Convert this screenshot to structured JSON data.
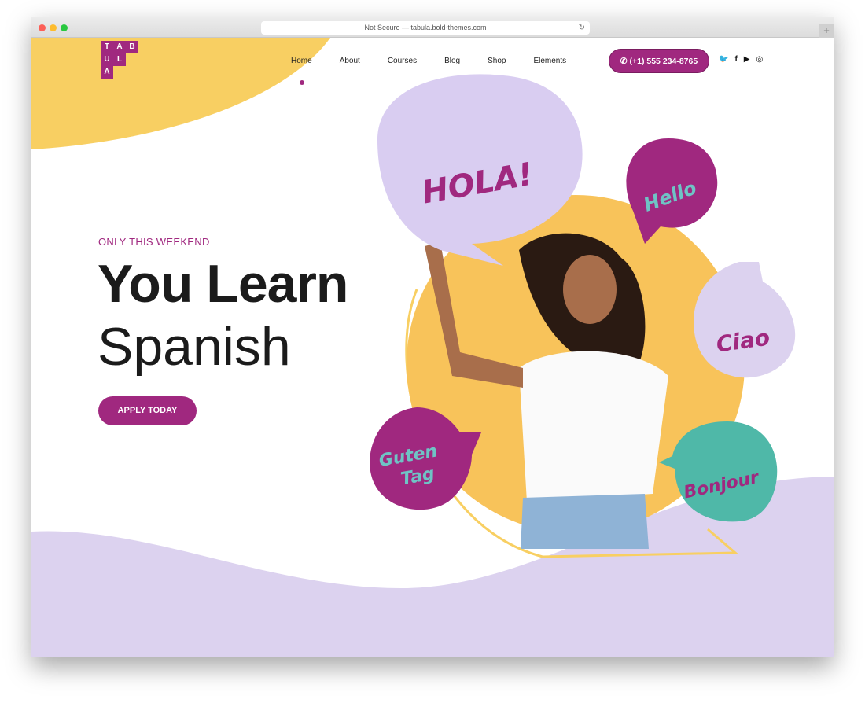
{
  "browser": {
    "url": "Not Secure — tabula.bold-themes.com"
  },
  "logo": {
    "letters": [
      "T",
      "A",
      "B",
      "U",
      "L",
      "A"
    ]
  },
  "nav": {
    "items": [
      "Home",
      "About",
      "Courses",
      "Blog",
      "Shop",
      "Elements"
    ],
    "active": "Home"
  },
  "phone": {
    "label": "(+1) 555 234-8765",
    "icon": "phone-icon"
  },
  "social": [
    "twitter-icon",
    "facebook-icon",
    "youtube-icon",
    "instagram-icon"
  ],
  "hero": {
    "eyebrow": "ONLY THIS WEEKEND",
    "title_bold": "You Learn",
    "title_light": "Spanish",
    "cta": "APPLY TODAY"
  },
  "bubbles": {
    "hola": "HOLA!",
    "hello": "Hello",
    "ciao": "Ciao",
    "guten1": "Guten",
    "guten2": "Tag",
    "bonjour": "Bonjour"
  },
  "colors": {
    "accent": "#a0287f",
    "yellow": "#f8cf62",
    "lavender": "#dcd2ef",
    "teal": "#4fb8a8"
  }
}
